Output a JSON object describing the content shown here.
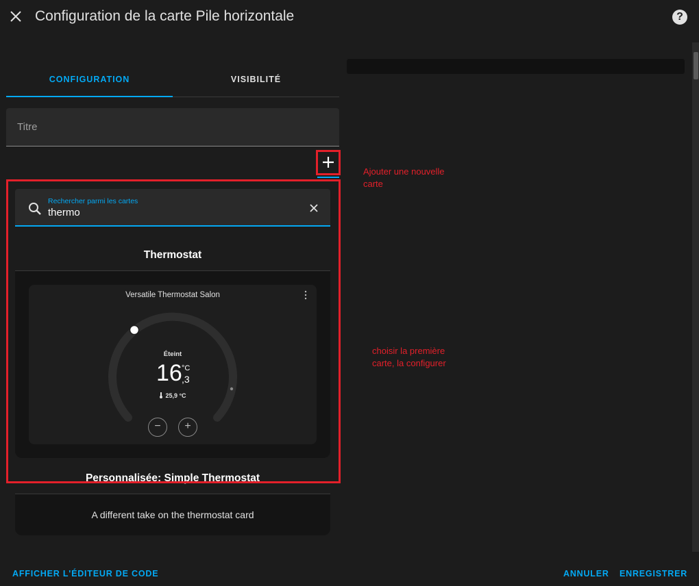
{
  "dialog": {
    "title": "Configuration de la carte Pile horizontale",
    "close_icon": "close-icon",
    "help_icon": "help-icon",
    "help_glyph": "?"
  },
  "tabs": [
    {
      "label": "CONFIGURATION",
      "active": true
    },
    {
      "label": "VISIBILITÉ",
      "active": false
    }
  ],
  "title_field": {
    "label": "Titre",
    "value": ""
  },
  "add_card": {
    "icon": "plus-icon"
  },
  "card_picker": {
    "search": {
      "label": "Rechercher parmi les cartes",
      "value": "thermo"
    },
    "cards": [
      {
        "title": "Thermostat",
        "preview": {
          "entity_name": "Versatile Thermostat Salon",
          "mode": "Éteint",
          "target_integer": "16",
          "target_decimal": ",3",
          "unit": "°C",
          "current_temperature": "25,9 °C",
          "minus": "−",
          "plus": "+"
        }
      },
      {
        "title": "Personnalisée: Simple Thermostat",
        "description": "A different take on the thermostat card"
      }
    ]
  },
  "annotations": {
    "add_card_note": "Ajouter une nouvelle carte",
    "choose_note": "choisir la première carte, la configurer"
  },
  "footer": {
    "show_code_editor": "AFFICHER L'ÉDITEUR DE CODE",
    "cancel": "ANNULER",
    "save": "ENREGISTRER"
  },
  "colors": {
    "accent": "#03a9f4",
    "annotation_red": "#e3202a",
    "background": "#1c1c1c"
  }
}
